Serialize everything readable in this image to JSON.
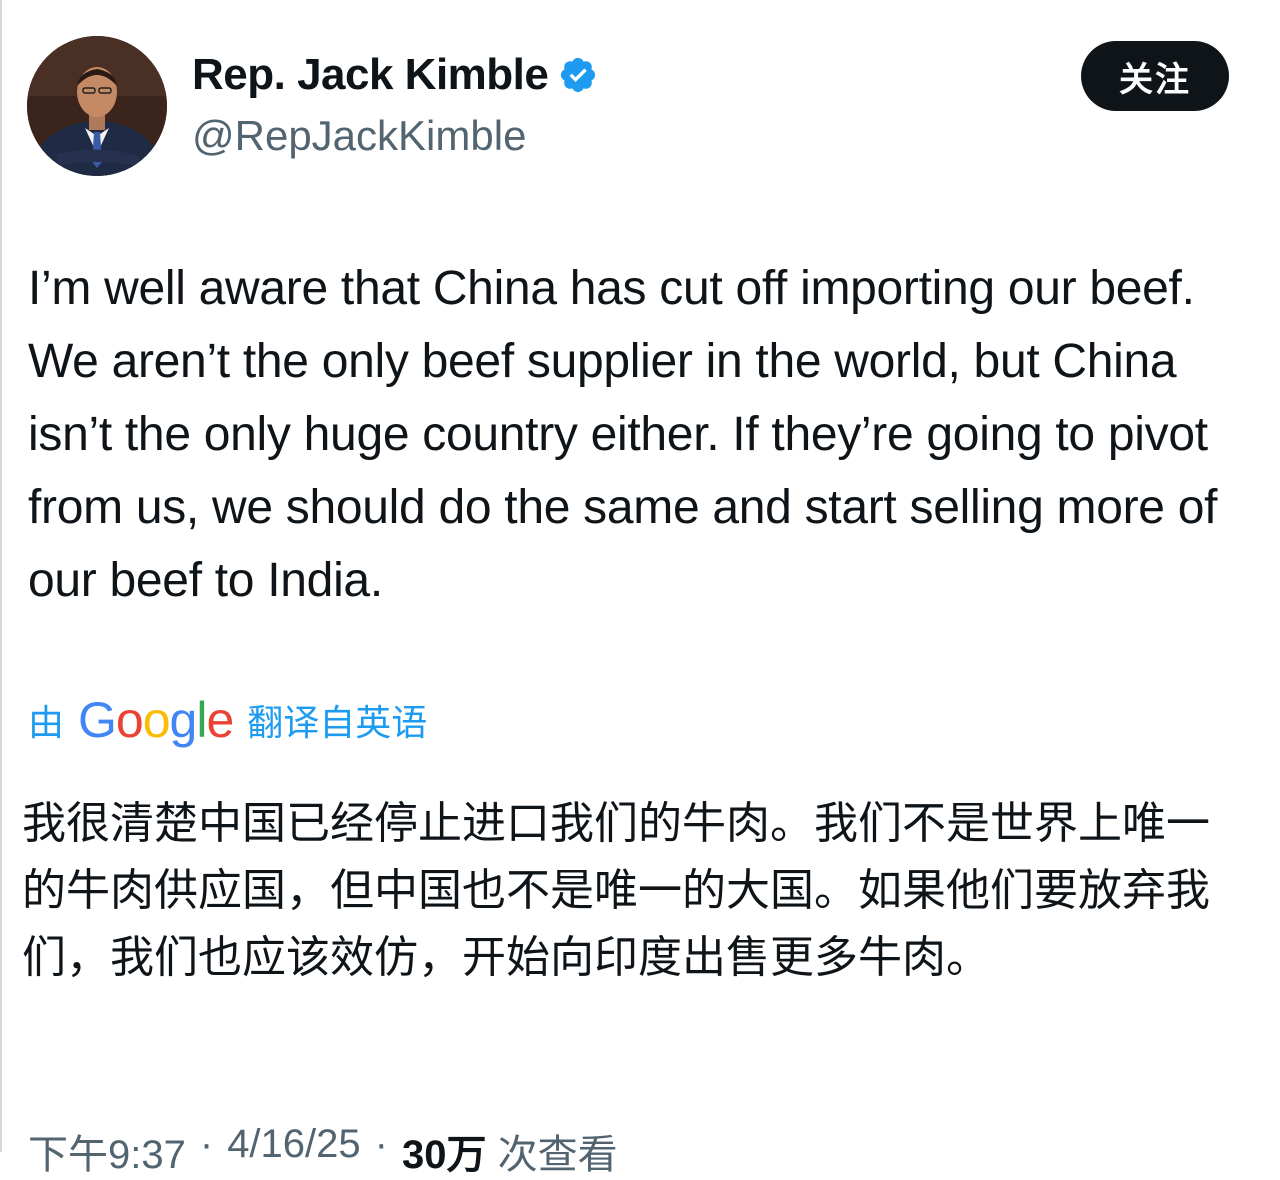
{
  "author": {
    "display_name": "Rep. Jack Kimble",
    "handle": "@RepJackKimble",
    "verified": true,
    "avatar_icon": "profile-photo"
  },
  "follow_button": {
    "label": "关注"
  },
  "tweet": {
    "text": "I’m well aware that China has cut off importing our beef. We aren’t the only beef supplier in the world, but China isn’t the only huge country either. If they’re going to pivot from us, we should do the same and start selling more of our beef to India."
  },
  "translation": {
    "prefix": "由",
    "provider_letters": [
      "G",
      "o",
      "o",
      "g",
      "l",
      "e"
    ],
    "suffix": "翻译自英语",
    "text": "我很清楚中国已经停止进口我们的牛肉。我们不是世界上唯一的牛肉供应国，但中国也不是唯一的大国。如果他们要放弃我们，我们也应该效仿，开始向印度出售更多牛肉。"
  },
  "meta": {
    "time": "下午9:37",
    "separator": "·",
    "date": "4/16/25",
    "views_count": "30万",
    "views_label": "次查看"
  },
  "colors": {
    "link": "#1d9bf0",
    "verified": "#1d9bf0",
    "button_bg": "#0f1419",
    "secondary_text": "#536471"
  }
}
